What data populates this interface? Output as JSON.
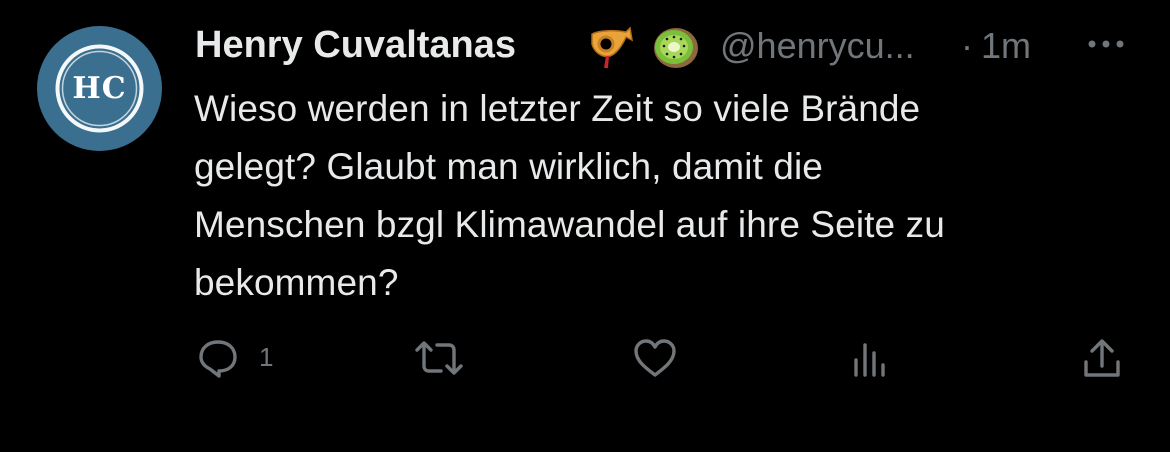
{
  "tweet": {
    "avatar_initials": "HC",
    "author_name": "Henry Cuvaltanas",
    "emojis": [
      "postal-horn-icon",
      "kiwi-icon"
    ],
    "handle": "@henrycu...",
    "separator": "·",
    "time": "1m",
    "text_lines": [
      "Wieso werden in letzter Zeit so viele Brände",
      "gelegt? Glaubt man wirklich, damit die",
      "Menschen bzgl Klimawandel auf ihre Seite zu",
      "bekommen?"
    ],
    "reply_count": "1"
  },
  "icons": {
    "more": "more-icon",
    "reply": "reply-icon",
    "retweet": "retweet-icon",
    "like": "heart-icon",
    "views": "views-icon",
    "share": "share-icon"
  },
  "colors": {
    "background": "#000000",
    "primary_text": "#e7e9ea",
    "secondary_text": "#71767b",
    "avatar_bg": "#3b6f8f"
  }
}
